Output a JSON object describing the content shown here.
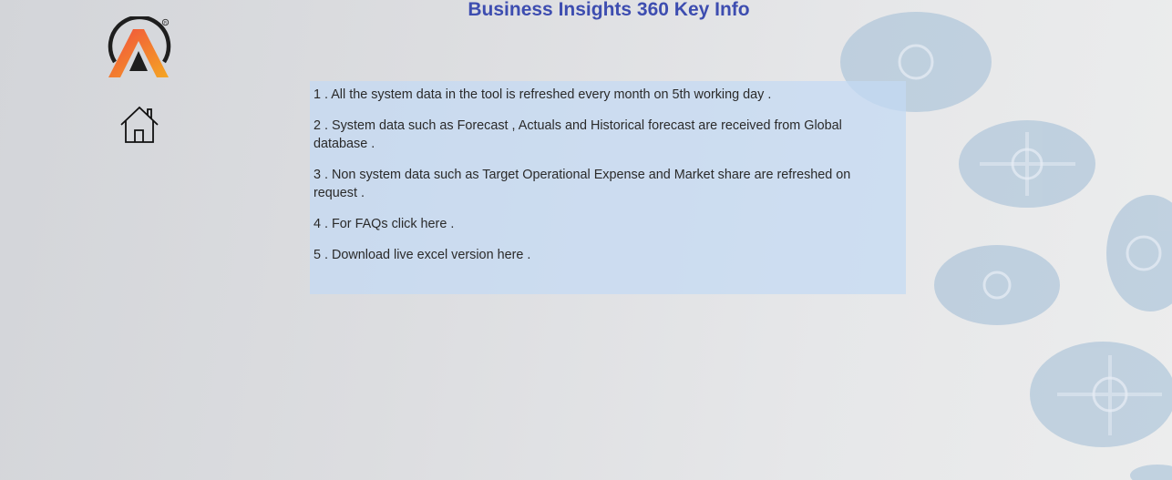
{
  "page": {
    "title": "Business Insights 360 Key Info"
  },
  "nav": {
    "logo_icon": "brand-logo-icon",
    "home_icon": "home-icon"
  },
  "info": {
    "items": [
      "1 . All the system data in the tool is refreshed every month on 5th working day .",
      "2 . System data such as Forecast , Actuals and Historical forecast are received from Global database .",
      "3 . Non system data such as Target Operational Expense and Market share are refreshed on request .",
      "4 . For FAQs click here .",
      "5 . Download live excel version here ."
    ]
  },
  "colors": {
    "title": "#3d4db0",
    "panel": "#c4daf4",
    "logo_gradient_start": "#f04e3e",
    "logo_gradient_end": "#f5a623",
    "logo_ring": "#1e1e1e"
  }
}
